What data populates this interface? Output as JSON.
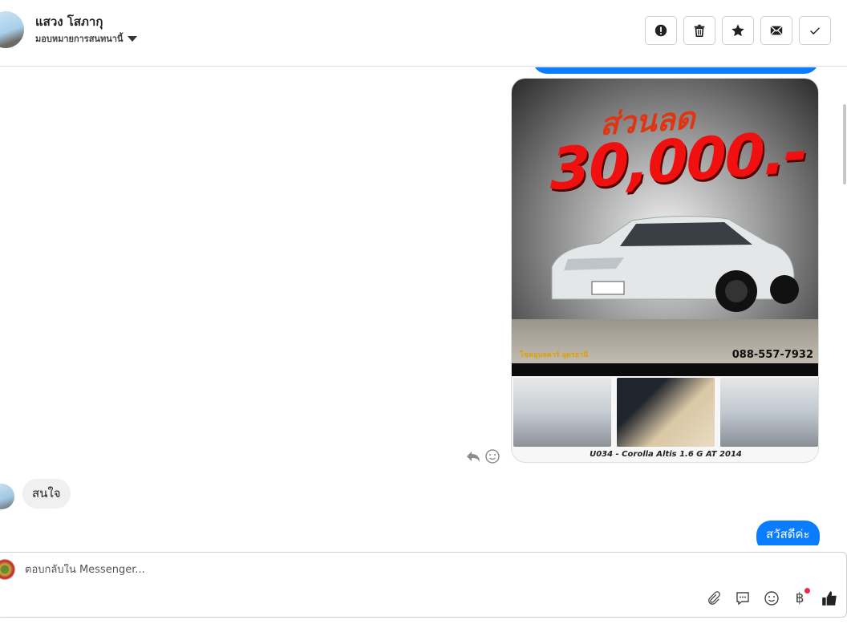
{
  "header": {
    "contact_name": "แสวง โสภากุ",
    "assign_label": "มอบหมายการสนทนานี้",
    "actions": [
      {
        "name": "spam",
        "icon": "exclamation-icon"
      },
      {
        "name": "delete",
        "icon": "trash-icon"
      },
      {
        "name": "star",
        "icon": "star-icon"
      },
      {
        "name": "mark-unread",
        "icon": "envelope-icon"
      },
      {
        "name": "done",
        "icon": "check-icon"
      }
    ]
  },
  "thread": {
    "image_card": {
      "promo_line1": "ส่วนลด",
      "promo_line2": "30,000.-",
      "dealer": "โชคอุบลคาร์ อุดรธานี",
      "phone": "088-557-7932",
      "caption": "U034 - Corolla Altis 1.6 G AT 2014"
    },
    "incoming_message": "สนใจ",
    "outgoing_message": "สวัสดีค่ะ"
  },
  "composer": {
    "placeholder": "ตอบกลับใน Messenger...",
    "tools": [
      "paperclip-icon",
      "saved-reply-icon",
      "emoji-icon",
      "baht-payment-icon",
      "thumbs-up-icon"
    ],
    "badge_color": "#f0284a"
  },
  "colors": {
    "accent": "#0a7cff"
  }
}
